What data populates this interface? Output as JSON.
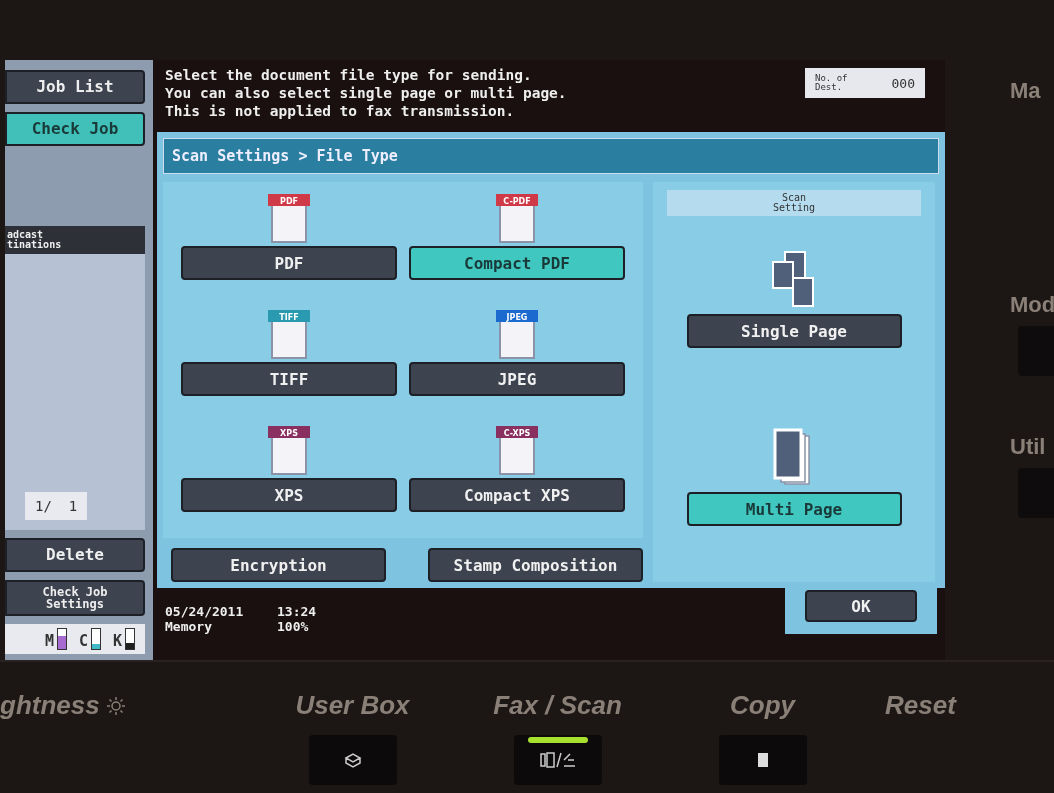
{
  "message": [
    "Select the document file type for sending.",
    "You can also select single page or multi page.",
    "This is not applied to fax transmission."
  ],
  "destinations": {
    "label": "No. of\nDest.",
    "count": "000"
  },
  "sidebar": {
    "buttons": [
      {
        "label": "Job List",
        "selected": false
      },
      {
        "label": "Check Job",
        "selected": true
      }
    ],
    "list_header": "adcast\ntinations",
    "pager": "1/  1",
    "delete": "Delete",
    "check_job_settings": "Check Job\nSettings",
    "toner": [
      {
        "label": "M",
        "level": 0.65,
        "color": "#a66ad0"
      },
      {
        "label": "C",
        "level": 0.25,
        "color": "#40b8c8"
      },
      {
        "label": "K",
        "level": 0.3,
        "color": "#202020"
      }
    ]
  },
  "breadcrumb": "Scan Settings > File Type",
  "file_types": [
    {
      "tag": "PDF",
      "label": "PDF",
      "color": "#d03a48",
      "selected": false
    },
    {
      "tag": "C-PDF",
      "label": "Compact PDF",
      "color": "#d03a48",
      "selected": true
    },
    {
      "tag": "TIFF",
      "label": "TIFF",
      "color": "#2a9ab0",
      "selected": false
    },
    {
      "tag": "JPEG",
      "label": "JPEG",
      "color": "#1a6ad0",
      "selected": false
    },
    {
      "tag": "XPS",
      "label": "XPS",
      "color": "#8a3060",
      "selected": false
    },
    {
      "tag": "C-XPS",
      "label": "Compact XPS",
      "color": "#8a3060",
      "selected": false
    }
  ],
  "scan_setting": {
    "title": "Scan\nSetting",
    "options": [
      {
        "label": "Single Page",
        "kind": "single",
        "selected": false
      },
      {
        "label": "Multi Page",
        "kind": "multi",
        "selected": true
      }
    ]
  },
  "extra_buttons": [
    "Encryption",
    "Stamp Composition"
  ],
  "status": {
    "date": "05/24/2011",
    "time": "13:24",
    "memory_label": "Memory",
    "memory": "100%"
  },
  "ok": "OK",
  "panel": {
    "right_labels": [
      "Ma",
      "Mod",
      "Util"
    ],
    "brightness": "ghtness",
    "keys": [
      {
        "label": "User Box",
        "kind": "box",
        "lit": false
      },
      {
        "label": "Fax / Scan",
        "kind": "fax",
        "lit": true
      },
      {
        "label": "Copy",
        "kind": "copy",
        "lit": false
      }
    ],
    "reset": "Reset"
  }
}
